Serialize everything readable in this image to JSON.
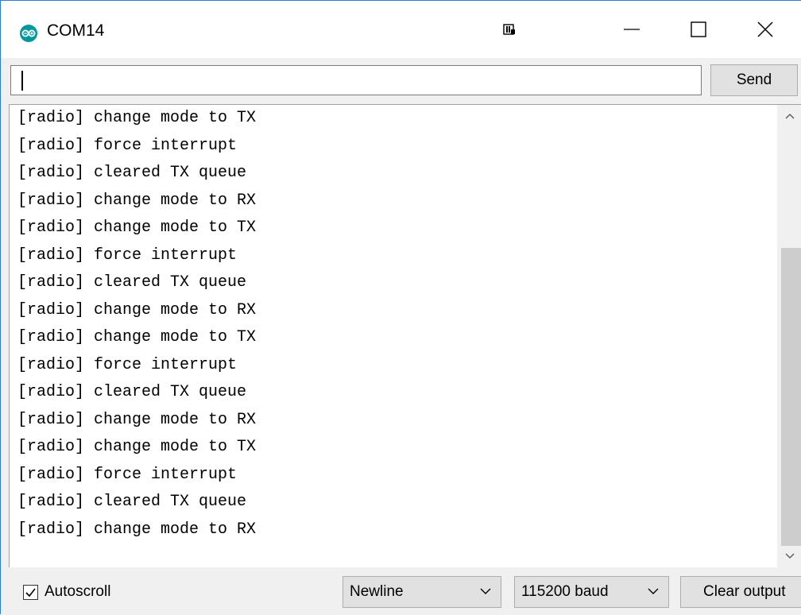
{
  "window": {
    "title": "COM14",
    "icon": "arduino-logo-icon"
  },
  "input": {
    "value": "",
    "placeholder": "",
    "send_label": "Send"
  },
  "output": {
    "lines": [
      "[radio] change mode to TX",
      "[radio] force interrupt",
      "[radio] cleared TX queue",
      "[radio] change mode to RX",
      "[radio] change mode to TX",
      "[radio] force interrupt",
      "[radio] cleared TX queue",
      "[radio] change mode to RX",
      "[radio] change mode to TX",
      "[radio] force interrupt",
      "[radio] cleared TX queue",
      "[radio] change mode to RX",
      "[radio] change mode to TX",
      "[radio] force interrupt",
      "[radio] cleared TX queue",
      "[radio] change mode to RX"
    ]
  },
  "footer": {
    "autoscroll_label": "Autoscroll",
    "autoscroll_checked": true,
    "line_ending": "Newline",
    "baud_rate": "115200 baud",
    "clear_label": "Clear output"
  },
  "colors": {
    "accent": "#00979d",
    "window_border": "#2b7cd3"
  }
}
